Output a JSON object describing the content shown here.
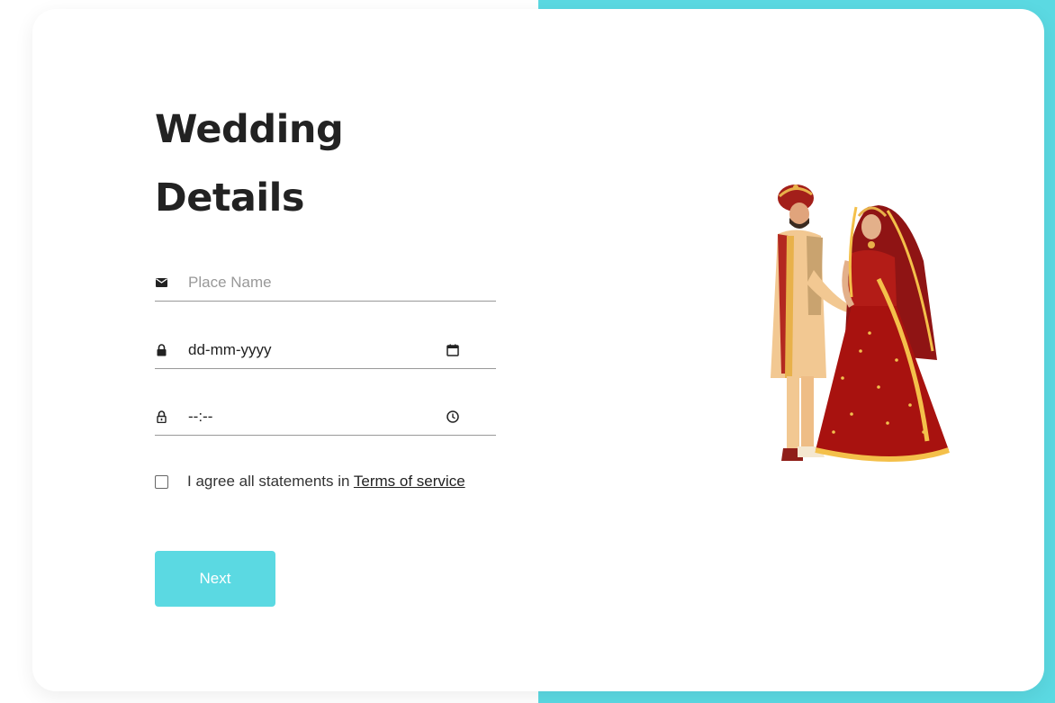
{
  "colors": {
    "accent": "#5bd9e2",
    "title": "#222222",
    "placeholder": "#999999"
  },
  "form": {
    "title_line1": "Wedding",
    "title_line2": "Details",
    "place_field": {
      "placeholder": "Place Name",
      "icon": "envelope-icon"
    },
    "date_field": {
      "value": "dd-mm-yyyy",
      "icon": "lock-icon",
      "picker_icon": "calendar-icon"
    },
    "time_field": {
      "value": "--:--",
      "icon": "lock-open-icon",
      "picker_icon": "clock-icon"
    },
    "agree": {
      "text": "I agree all statements in ",
      "link": "Terms of service",
      "checked": false
    },
    "next_button": "Next"
  },
  "illustration": {
    "name": "wedding-couple-illustration"
  }
}
